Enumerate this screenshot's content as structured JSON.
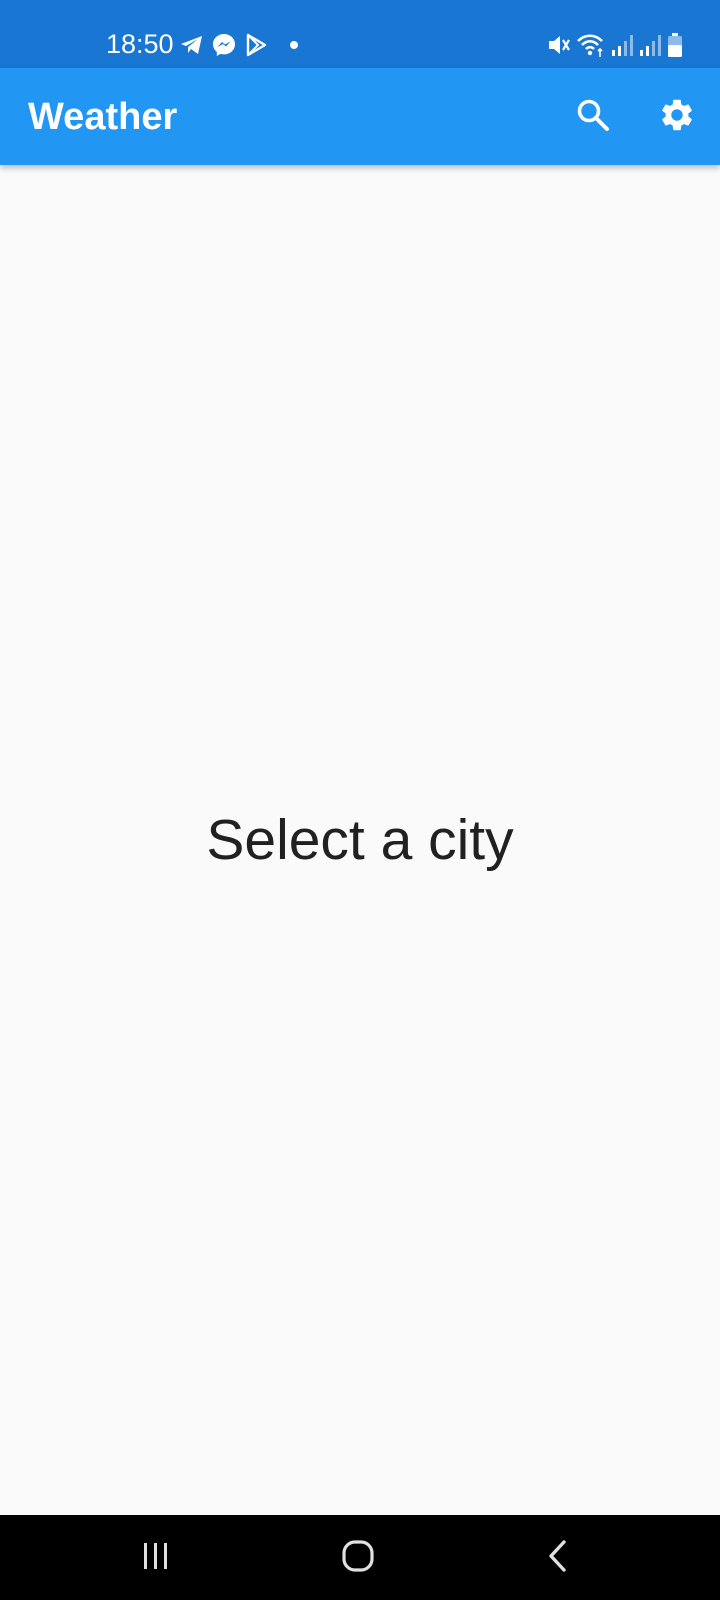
{
  "status_bar": {
    "time": "18:50",
    "left_icons": [
      "telegram-icon",
      "messenger-icon",
      "play-store-icon",
      "notification-dot-icon"
    ],
    "right_icons": [
      "mute-icon",
      "wifi-icon",
      "signal-icon",
      "signal-icon",
      "battery-icon"
    ]
  },
  "app_bar": {
    "title": "Weather",
    "actions": [
      "search-icon",
      "gear-icon"
    ]
  },
  "main": {
    "empty_message": "Select a city"
  },
  "nav_bar": {
    "buttons": [
      "recents-icon",
      "home-icon",
      "back-icon"
    ]
  },
  "colors": {
    "status_bar": "#1976d2",
    "app_bar": "#2196f3",
    "background": "#fafafa",
    "text": "#212121",
    "nav_bar": "#000000"
  }
}
